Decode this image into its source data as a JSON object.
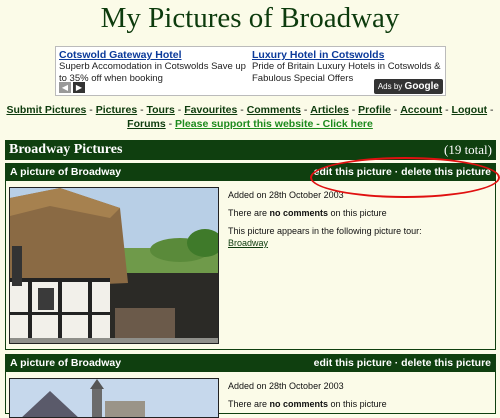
{
  "page": {
    "title": "My Pictures of Broadway"
  },
  "ads": {
    "items": [
      {
        "headline": "Cotswold Gateway Hotel",
        "body": "Superb Accomodation in Cotswolds Save up to 35% off when booking"
      },
      {
        "headline": "Luxury Hotel in Cotswolds",
        "body": "Pride of Britain Luxury Hotels in Cotswolds & Fabulous Special Offers"
      }
    ],
    "prev_glyph": "◀",
    "next_glyph": "▶",
    "ads_by_label": "Ads by",
    "ads_by_brand": "Google"
  },
  "nav": {
    "links": [
      "Submit Pictures",
      "Pictures",
      "Tours",
      "Favourites",
      "Comments",
      "Articles",
      "Profile",
      "Account",
      "Logout",
      "Forums"
    ],
    "support": "Please support this website - Click here",
    "separator": " - "
  },
  "section": {
    "title": "Broadway Pictures",
    "count": "(19 total)"
  },
  "pictures": [
    {
      "title": "A picture of Broadway",
      "edit": "edit this picture",
      "sep": " · ",
      "delete": "delete this picture",
      "added": "Added on 28th October 2003",
      "comments_pre": "There are ",
      "comments_bold": "no comments",
      "comments_post": " on this picture",
      "tour_text": "This picture appears in the following picture tour:",
      "tour_link": "Broadway"
    },
    {
      "title": "A picture of Broadway",
      "edit": "edit this picture",
      "sep": " · ",
      "delete": "delete this picture",
      "added": "Added on 28th October 2003",
      "comments_pre": "There are ",
      "comments_bold": "no comments",
      "comments_post": " on this picture"
    }
  ]
}
